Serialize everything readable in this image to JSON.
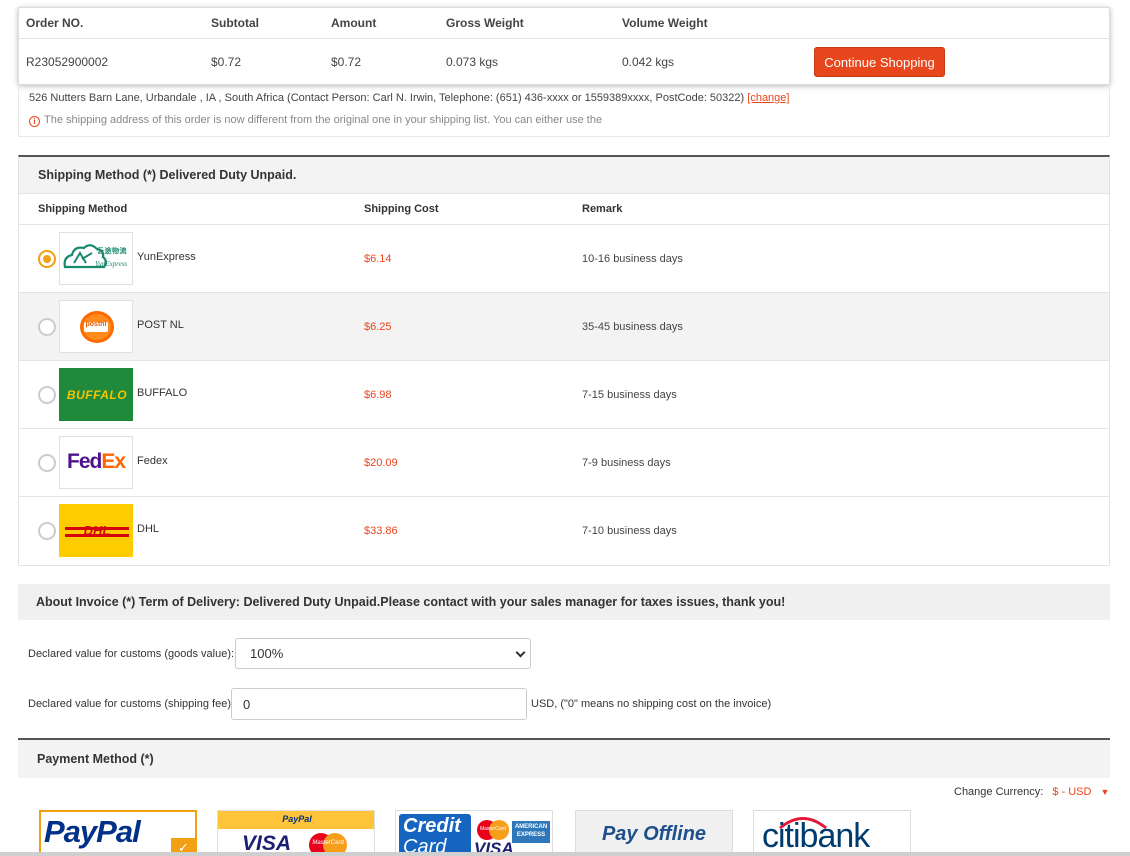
{
  "order": {
    "headers": {
      "order_no": "Order NO.",
      "subtotal": "Subtotal",
      "amount": "Amount",
      "gross_weight": "Gross Weight",
      "volume_weight": "Volume Weight"
    },
    "row": {
      "order_no": "R23052900002",
      "subtotal": "$0.72",
      "amount": "$0.72",
      "gross_weight": "0.073 kgs",
      "volume_weight": "0.042 kgs"
    },
    "continue_label": "Continue Shopping"
  },
  "address": {
    "text": "526 Nutters Barn Lane, Urbandale , IA , South Africa (Contact Person: Carl N. Irwin, Telephone: (651) 436-xxxx or 1559389xxxx, PostCode: 50322)",
    "change_label": "[change]",
    "notice": "The shipping address of this order is now different from the original one in your shipping list. You can either use the",
    "notice_icon": "i"
  },
  "shipping": {
    "title": "Shipping Method (*) Delivered Duty Unpaid.",
    "columns": {
      "method": "Shipping Method",
      "cost": "Shipping Cost",
      "remark": "Remark"
    },
    "rows": [
      {
        "name": "YunExpress",
        "cost": "$6.14",
        "remark": "10-16 business days",
        "logo_cn": "云途物流",
        "logo_en": "YunExpress"
      },
      {
        "name": "POST NL",
        "cost": "$6.25",
        "remark": "35-45 business days",
        "logo_text": "postnl"
      },
      {
        "name": "BUFFALO",
        "cost": "$6.98",
        "remark": "7-15 business days",
        "logo_text": "BUFFALO"
      },
      {
        "name": "Fedex",
        "cost": "$20.09",
        "remark": "7-9 business days",
        "logo_fed": "Fed",
        "logo_ex": "Ex"
      },
      {
        "name": "DHL",
        "cost": "$33.86",
        "remark": "7-10 business days",
        "logo_text": "DHL"
      }
    ],
    "selected_index": 0
  },
  "invoice": {
    "title": "About Invoice (*) Term of Delivery: Delivered Duty Unpaid.Please contact with your sales manager for taxes issues, thank you!",
    "goods_label": "Declared value for customs (goods value):",
    "goods_value": "100%",
    "fee_label": "Declared value for customs (shipping fee)",
    "fee_value": "0",
    "fee_note": "USD, (\"0\" means no shipping cost on the invoice)"
  },
  "payment": {
    "title": "Payment Method (*)",
    "currency_label": "Change Currency:",
    "currency_value": "$ - USD",
    "cards": {
      "paypal": {
        "text": "PayPal"
      },
      "paypal_cards": {
        "header": "PayPal",
        "visa": "VISA",
        "mc": "MasterCard"
      },
      "credit": {
        "line1": "Credit",
        "line2": "Card",
        "visa": "VISA",
        "amex1": "AMERICAN",
        "amex2": "EXPRESS",
        "mc": "MasterCard"
      },
      "offline": {
        "text": "Pay Offline"
      },
      "citi": {
        "text": "citibank"
      }
    }
  },
  "colors": {
    "accent": "#e8461d",
    "radio_selected": "#f0a012",
    "fedex_purple": "#4d148c",
    "fedex_orange": "#ff6600",
    "dhl_yellow": "#ffcc00",
    "dhl_red": "#d40511",
    "buffalo_green": "#1f8a3b",
    "paypal_blue": "#003087",
    "paypal_light": "#009cde"
  }
}
